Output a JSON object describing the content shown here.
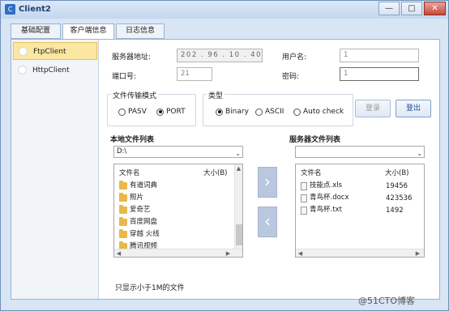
{
  "window": {
    "title": "Client2",
    "min": "—",
    "max": "□",
    "close": "✕"
  },
  "tabs": [
    "基础配置",
    "客户端信息",
    "日志信息"
  ],
  "sidebar": {
    "items": [
      {
        "label": "FtpClient"
      },
      {
        "label": "HttpClient"
      }
    ]
  },
  "form": {
    "server_label": "服务器地址:",
    "server_value": "202 . 96 . 10 . 40",
    "user_label": "用户名:",
    "user_value": "1",
    "port_label": "端口号:",
    "port_value": "21",
    "pass_label": "密码:",
    "pass_value": "1"
  },
  "transfer_mode": {
    "title": "文件传输模式",
    "options": [
      "PASV",
      "PORT"
    ],
    "selected": "PORT"
  },
  "type": {
    "title": "类型",
    "options": [
      "Binary",
      "ASCII",
      "Auto check"
    ],
    "selected": "Binary"
  },
  "buttons": {
    "login": "登录",
    "logout": "登出"
  },
  "local": {
    "title": "本地文件列表",
    "path": "D:\\",
    "col_name": "文件名",
    "col_size": "大小(B)",
    "files": [
      "有道词典",
      "照片",
      "爱奇艺",
      "百度网盘",
      "穿越 火线",
      "腾讯视频"
    ]
  },
  "server": {
    "title": "服务器文件列表",
    "path": "",
    "col_name": "文件名",
    "col_size": "大小(B)",
    "files": [
      {
        "name": "技能点.xls",
        "size": "19456"
      },
      {
        "name": "青鸟杯.docx",
        "size": "423536"
      },
      {
        "name": "青鸟杯.txt",
        "size": "1492"
      }
    ]
  },
  "footer_note": "只显示小于1M的文件",
  "watermark": "@51CTO博客",
  "colors": {
    "accent": "#2f6fc4",
    "selected_bg": "#fbe6a2",
    "transfer_btn": "#b9c8de"
  }
}
